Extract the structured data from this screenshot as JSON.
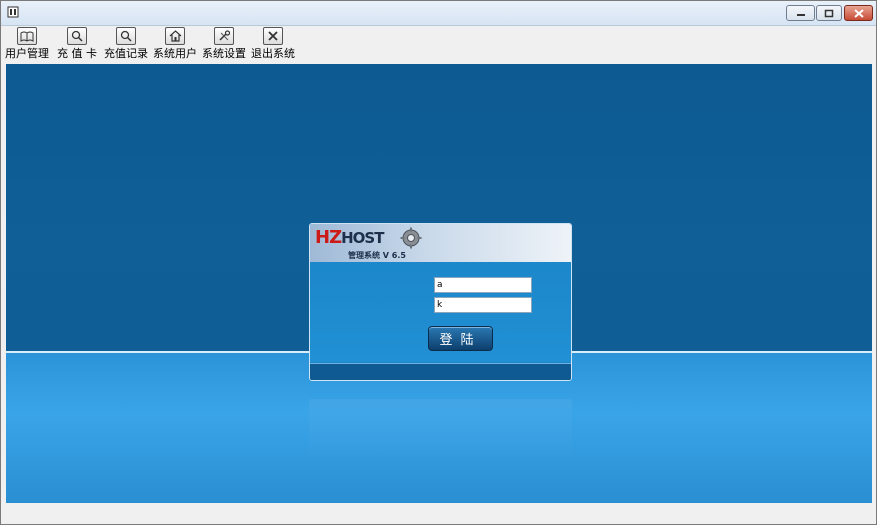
{
  "window": {
    "title": "",
    "controls": {
      "minimize": "minimize-icon",
      "maximize": "maximize-icon",
      "close": "close-icon"
    }
  },
  "toolbar": {
    "items": [
      {
        "label": "用户管理",
        "icon": "book-icon"
      },
      {
        "label": "充 值 卡",
        "icon": "search-icon"
      },
      {
        "label": "充值记录",
        "icon": "search-icon"
      },
      {
        "label": "系统用户",
        "icon": "home-icon"
      },
      {
        "label": "系统设置",
        "icon": "tools-icon"
      },
      {
        "label": "退出系统",
        "icon": "close-icon"
      }
    ]
  },
  "login": {
    "logo_hz": "HZ",
    "logo_host": "HOST",
    "subtitle": "管理系统 V 6.5",
    "username_value": "a",
    "password_value": "k",
    "login_label": "登陆"
  },
  "colors": {
    "stage_dark": "#0f5c94",
    "stage_light": "#3aa4e8",
    "logo_red": "#cc1a17"
  }
}
